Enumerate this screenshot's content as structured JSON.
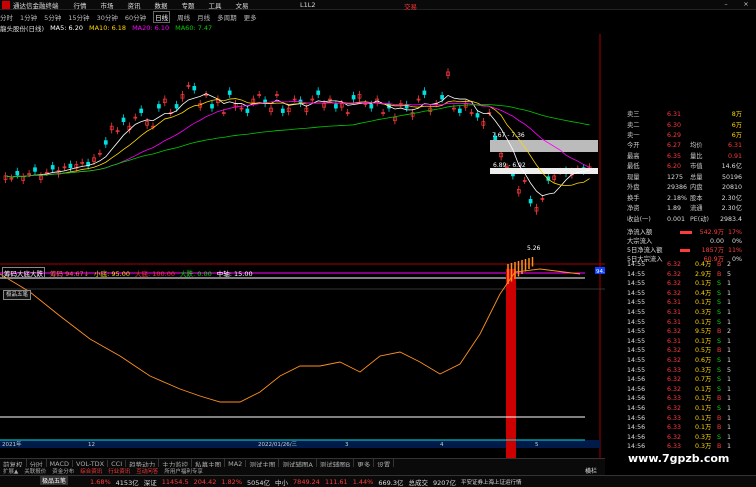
{
  "window": {
    "title": "通达信金融终端",
    "menus": [
      "行情",
      "市场",
      "资讯",
      "数据",
      "专题",
      "工具",
      "文易"
    ],
    "right": "L1L2",
    "brand": "交易"
  },
  "periods": [
    "分时",
    "1分钟",
    "5分钟",
    "15分钟",
    "30分钟",
    "60分钟",
    "日线",
    "周线",
    "月线",
    "多周期",
    "更多"
  ],
  "active_period": "日线",
  "stock": {
    "name": "龍头股份(日线)",
    "ma5": "MA5: 6.20",
    "ma10": "MA10: 6.18",
    "ma20": "MA20: 6.10",
    "ma60": "MA60: 7.47"
  },
  "colors": {
    "up": "#ff3b3b",
    "down": "#00e0e0",
    "ma5": "#ffffff",
    "ma10": "#ffd700",
    "ma20": "#ff00ff",
    "ma60": "#00cc00",
    "bg": "#000000"
  },
  "price_axis": [
    "8.00",
    "7.50",
    "7.00",
    "6.50",
    "6.00",
    "5.50"
  ],
  "annotations": {
    "box1": "7.67 - 7.36",
    "box2": "6.89 - 6.92",
    "low": "5.26"
  },
  "indicator1": {
    "label": "筹码大底大跌",
    "v1": "筹码 94.67↓",
    "v2": "小底: 95.00",
    "v3": "大底: 100.00",
    "v4": "大跌: 0.00",
    "v5": "中轴: 15.00",
    "axis": [
      "100.00",
      "90.00",
      "80.00",
      "70.00",
      "60.00",
      "50.00",
      "40.00",
      "30.00",
      "20.00",
      "10.00",
      "0.00"
    ],
    "badge": "94.35"
  },
  "indicator2": {
    "label": "极品五笔"
  },
  "dates": {
    "d1": "2021年",
    "d2": "12",
    "d3": "2022/01/26/三",
    "d4": "3",
    "d5": "4",
    "d6": "5"
  },
  "tabs": [
    "前复权",
    "分时",
    "MACD",
    "VOL-TDX",
    "CCI",
    "趋势动力",
    "主力监控",
    "私募主图",
    "MA2",
    "测试主图",
    "测试辅图A",
    "测试辅图B",
    "更多",
    "设置"
  ],
  "tabs2": [
    "扩展▲",
    "关联报价",
    "资金分布",
    "综合资讯",
    "行业资讯",
    "互动问答",
    "所用户福利专享"
  ],
  "quote_top": [
    {
      "k": "卖三",
      "p": "6.31",
      "v": "8万"
    },
    {
      "k": "卖二",
      "p": "6.30",
      "v": "6万"
    },
    {
      "k": "卖一",
      "p": "6.29",
      "v": "6万"
    },
    {
      "k": "今开",
      "p": "6.27",
      "k2": "均价",
      "v": "6.31"
    },
    {
      "k": "最高",
      "p": "6.35",
      "k2": "量比",
      "v": "0.91"
    },
    {
      "k": "最低",
      "p": "6.20",
      "k2": "市值",
      "v": "14.6亿"
    },
    {
      "k": "现量",
      "p": "1275",
      "k2": "总量",
      "v": "50196"
    },
    {
      "k": "外盘",
      "p": "29386",
      "k2": "内盘",
      "v": "20810"
    },
    {
      "k": "换手",
      "p": "2.18%",
      "k2": "股本",
      "v": "2.30亿"
    },
    {
      "k": "净资",
      "p": "1.89",
      "k2": "流通",
      "v": "2.30亿"
    },
    {
      "k": "收益(一)",
      "p": "0.001",
      "k2": "PE(动)",
      "v": "2983.4"
    }
  ],
  "flows": [
    {
      "k": "净流入额",
      "v": "542.9万",
      "p": "17%"
    },
    {
      "k": "大宗流入",
      "v": "0.00",
      "p": "0%"
    },
    {
      "k": "5日净流入额",
      "v": "1857万",
      "p": "11%"
    },
    {
      "k": "5日大宗流入",
      "v": "60.9万",
      "p": "0%"
    }
  ],
  "ticks": [
    [
      "14:55",
      "6.32",
      "0.4万",
      "B",
      "2"
    ],
    [
      "14:55",
      "6.32",
      "2.9万",
      "B",
      "5"
    ],
    [
      "14:55",
      "6.32",
      "0.1万",
      "S",
      "1"
    ],
    [
      "14:55",
      "6.32",
      "0.4万",
      "S",
      "1"
    ],
    [
      "14:55",
      "6.31",
      "0.1万",
      "S",
      "1"
    ],
    [
      "14:55",
      "6.31",
      "0.3万",
      "S",
      "1"
    ],
    [
      "14:55",
      "6.31",
      "0.1万",
      "S",
      "1"
    ],
    [
      "14:55",
      "6.32",
      "9.5万",
      "B",
      "2"
    ],
    [
      "14:55",
      "6.31",
      "0.1万",
      "S",
      "1"
    ],
    [
      "14:55",
      "6.32",
      "0.5万",
      "B",
      "1"
    ],
    [
      "14:55",
      "6.32",
      "0.6万",
      "S",
      "1"
    ],
    [
      "14:55",
      "6.33",
      "0.3万",
      "S",
      "5"
    ],
    [
      "14:56",
      "6.32",
      "0.7万",
      "S",
      "1"
    ],
    [
      "14:56",
      "6.32",
      "0.1万",
      "S",
      "1"
    ],
    [
      "14:56",
      "6.33",
      "0.1万",
      "B",
      "1"
    ],
    [
      "14:56",
      "6.32",
      "0.1万",
      "S",
      "1"
    ],
    [
      "14:56",
      "6.33",
      "0.1万",
      "B",
      "1"
    ],
    [
      "14:56",
      "6.33",
      "0.1万",
      "B",
      "1"
    ],
    [
      "14:56",
      "6.32",
      "0.3万",
      "S",
      "1"
    ],
    [
      "14:56",
      "6.33",
      "0.3万",
      "B",
      "1"
    ]
  ],
  "status": {
    "idx1": "1.68%",
    "v1": "4153亿",
    "idx2name": "深证",
    "idx2": "11454.5",
    "idx2c": "204.42",
    "idx2p": "1.82%",
    "v2": "5054亿",
    "idx3name": "中小",
    "idx3": "7849.24",
    "idx3c": "111.61",
    "idx3p": "1.44%",
    "v3": "669.3亿",
    "total": "总成交",
    "tv": "9207亿",
    "note": "平安证券上海上证运行情"
  },
  "side_tabs": [
    "极品五笔",
    "横栏"
  ],
  "watermark": "www.7gpzb.com"
}
